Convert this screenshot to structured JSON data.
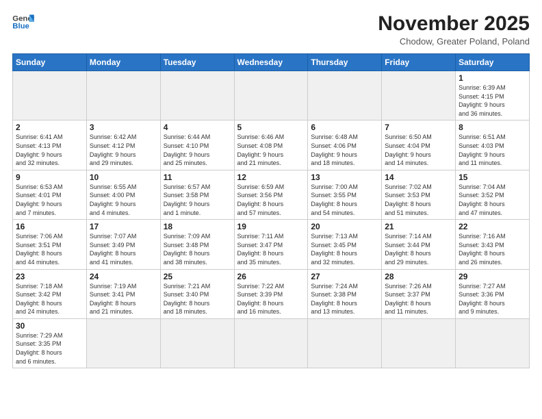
{
  "logo": {
    "text_general": "General",
    "text_blue": "Blue"
  },
  "header": {
    "month_title": "November 2025",
    "subtitle": "Chodow, Greater Poland, Poland"
  },
  "weekdays": [
    "Sunday",
    "Monday",
    "Tuesday",
    "Wednesday",
    "Thursday",
    "Friday",
    "Saturday"
  ],
  "weeks": [
    [
      {
        "day": "",
        "info": ""
      },
      {
        "day": "",
        "info": ""
      },
      {
        "day": "",
        "info": ""
      },
      {
        "day": "",
        "info": ""
      },
      {
        "day": "",
        "info": ""
      },
      {
        "day": "",
        "info": ""
      },
      {
        "day": "1",
        "info": "Sunrise: 6:39 AM\nSunset: 4:15 PM\nDaylight: 9 hours\nand 36 minutes."
      }
    ],
    [
      {
        "day": "2",
        "info": "Sunrise: 6:41 AM\nSunset: 4:13 PM\nDaylight: 9 hours\nand 32 minutes."
      },
      {
        "day": "3",
        "info": "Sunrise: 6:42 AM\nSunset: 4:12 PM\nDaylight: 9 hours\nand 29 minutes."
      },
      {
        "day": "4",
        "info": "Sunrise: 6:44 AM\nSunset: 4:10 PM\nDaylight: 9 hours\nand 25 minutes."
      },
      {
        "day": "5",
        "info": "Sunrise: 6:46 AM\nSunset: 4:08 PM\nDaylight: 9 hours\nand 21 minutes."
      },
      {
        "day": "6",
        "info": "Sunrise: 6:48 AM\nSunset: 4:06 PM\nDaylight: 9 hours\nand 18 minutes."
      },
      {
        "day": "7",
        "info": "Sunrise: 6:50 AM\nSunset: 4:04 PM\nDaylight: 9 hours\nand 14 minutes."
      },
      {
        "day": "8",
        "info": "Sunrise: 6:51 AM\nSunset: 4:03 PM\nDaylight: 9 hours\nand 11 minutes."
      }
    ],
    [
      {
        "day": "9",
        "info": "Sunrise: 6:53 AM\nSunset: 4:01 PM\nDaylight: 9 hours\nand 7 minutes."
      },
      {
        "day": "10",
        "info": "Sunrise: 6:55 AM\nSunset: 4:00 PM\nDaylight: 9 hours\nand 4 minutes."
      },
      {
        "day": "11",
        "info": "Sunrise: 6:57 AM\nSunset: 3:58 PM\nDaylight: 9 hours\nand 1 minute."
      },
      {
        "day": "12",
        "info": "Sunrise: 6:59 AM\nSunset: 3:56 PM\nDaylight: 8 hours\nand 57 minutes."
      },
      {
        "day": "13",
        "info": "Sunrise: 7:00 AM\nSunset: 3:55 PM\nDaylight: 8 hours\nand 54 minutes."
      },
      {
        "day": "14",
        "info": "Sunrise: 7:02 AM\nSunset: 3:53 PM\nDaylight: 8 hours\nand 51 minutes."
      },
      {
        "day": "15",
        "info": "Sunrise: 7:04 AM\nSunset: 3:52 PM\nDaylight: 8 hours\nand 47 minutes."
      }
    ],
    [
      {
        "day": "16",
        "info": "Sunrise: 7:06 AM\nSunset: 3:51 PM\nDaylight: 8 hours\nand 44 minutes."
      },
      {
        "day": "17",
        "info": "Sunrise: 7:07 AM\nSunset: 3:49 PM\nDaylight: 8 hours\nand 41 minutes."
      },
      {
        "day": "18",
        "info": "Sunrise: 7:09 AM\nSunset: 3:48 PM\nDaylight: 8 hours\nand 38 minutes."
      },
      {
        "day": "19",
        "info": "Sunrise: 7:11 AM\nSunset: 3:47 PM\nDaylight: 8 hours\nand 35 minutes."
      },
      {
        "day": "20",
        "info": "Sunrise: 7:13 AM\nSunset: 3:45 PM\nDaylight: 8 hours\nand 32 minutes."
      },
      {
        "day": "21",
        "info": "Sunrise: 7:14 AM\nSunset: 3:44 PM\nDaylight: 8 hours\nand 29 minutes."
      },
      {
        "day": "22",
        "info": "Sunrise: 7:16 AM\nSunset: 3:43 PM\nDaylight: 8 hours\nand 26 minutes."
      }
    ],
    [
      {
        "day": "23",
        "info": "Sunrise: 7:18 AM\nSunset: 3:42 PM\nDaylight: 8 hours\nand 24 minutes."
      },
      {
        "day": "24",
        "info": "Sunrise: 7:19 AM\nSunset: 3:41 PM\nDaylight: 8 hours\nand 21 minutes."
      },
      {
        "day": "25",
        "info": "Sunrise: 7:21 AM\nSunset: 3:40 PM\nDaylight: 8 hours\nand 18 minutes."
      },
      {
        "day": "26",
        "info": "Sunrise: 7:22 AM\nSunset: 3:39 PM\nDaylight: 8 hours\nand 16 minutes."
      },
      {
        "day": "27",
        "info": "Sunrise: 7:24 AM\nSunset: 3:38 PM\nDaylight: 8 hours\nand 13 minutes."
      },
      {
        "day": "28",
        "info": "Sunrise: 7:26 AM\nSunset: 3:37 PM\nDaylight: 8 hours\nand 11 minutes."
      },
      {
        "day": "29",
        "info": "Sunrise: 7:27 AM\nSunset: 3:36 PM\nDaylight: 8 hours\nand 9 minutes."
      }
    ],
    [
      {
        "day": "30",
        "info": "Sunrise: 7:29 AM\nSunset: 3:35 PM\nDaylight: 8 hours\nand 6 minutes."
      },
      {
        "day": "",
        "info": ""
      },
      {
        "day": "",
        "info": ""
      },
      {
        "day": "",
        "info": ""
      },
      {
        "day": "",
        "info": ""
      },
      {
        "day": "",
        "info": ""
      },
      {
        "day": "",
        "info": ""
      }
    ]
  ]
}
